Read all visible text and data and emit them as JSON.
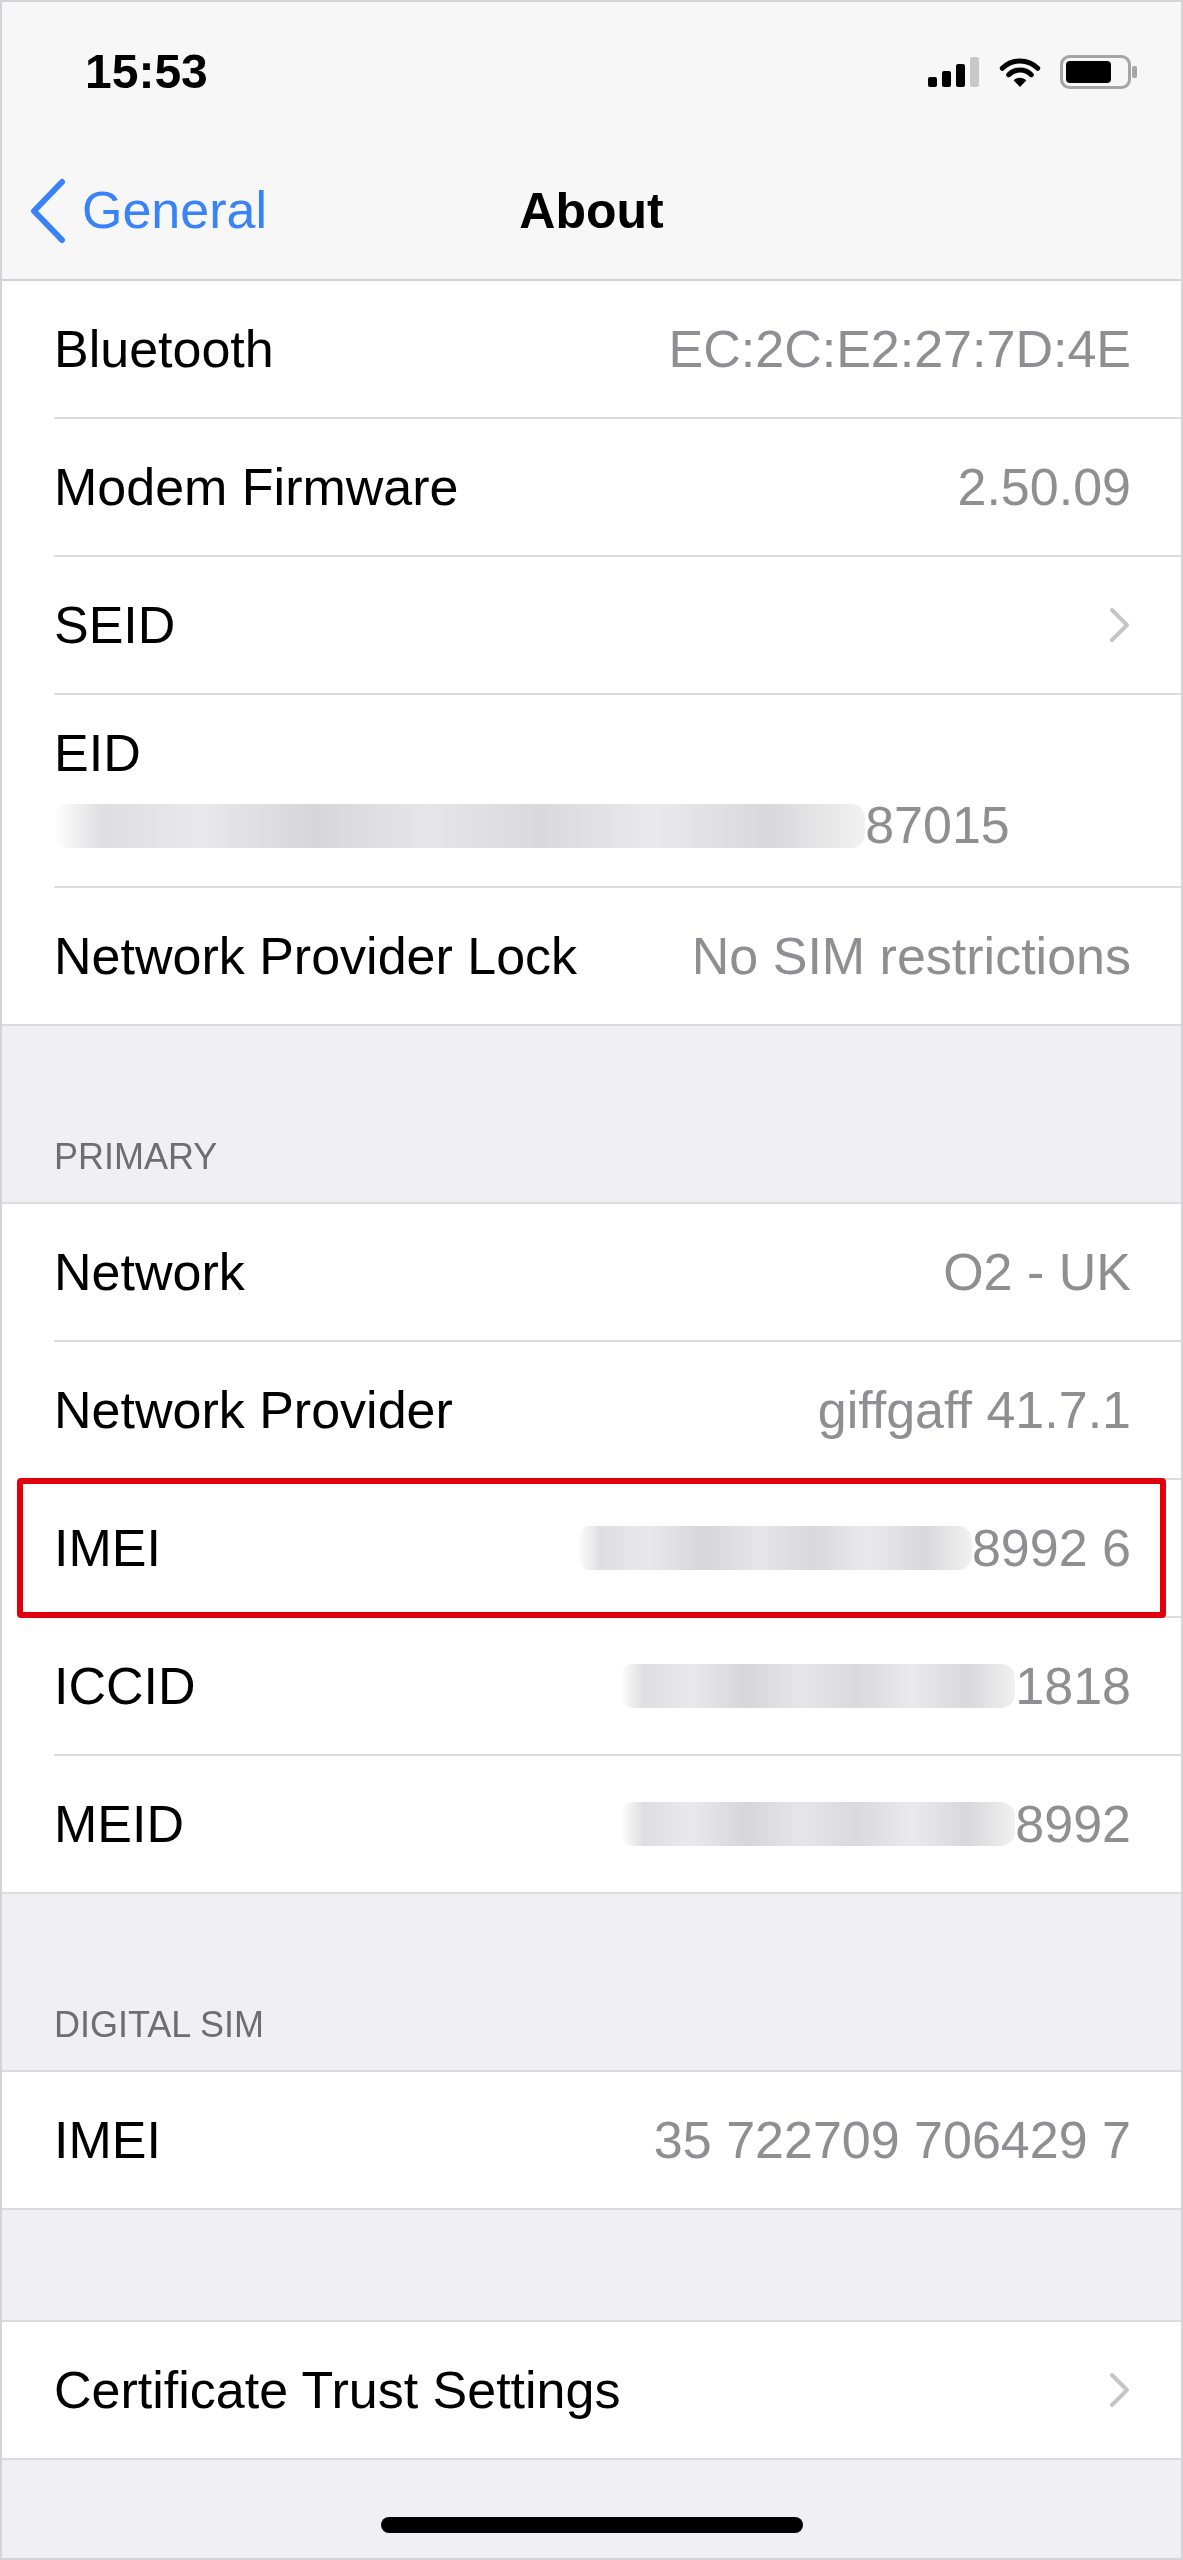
{
  "status_bar": {
    "time": "15:53"
  },
  "nav": {
    "back_label": "General",
    "title": "About"
  },
  "groups": [
    {
      "rows": [
        {
          "kind": "value",
          "label": "Bluetooth",
          "value": "EC:2C:E2:27:7D:4E",
          "redacted": false,
          "highlighted": false
        },
        {
          "kind": "value",
          "label": "Modem Firmware",
          "value": "2.50.09",
          "redacted": false,
          "highlighted": false
        },
        {
          "kind": "link",
          "label": "SEID",
          "highlighted": false
        },
        {
          "kind": "stacked",
          "label": "EID",
          "value": "87015",
          "redacted": true,
          "highlighted": false
        },
        {
          "kind": "value",
          "label": "Network Provider Lock",
          "value": "No SIM restrictions",
          "redacted": false,
          "highlighted": false
        }
      ]
    },
    {
      "header": "PRIMARY",
      "rows": [
        {
          "kind": "value",
          "label": "Network",
          "value": "O2 - UK",
          "redacted": false,
          "highlighted": false
        },
        {
          "kind": "value",
          "label": "Network Provider",
          "value": "giffgaff 41.7.1",
          "redacted": false,
          "highlighted": false
        },
        {
          "kind": "value",
          "label": "IMEI",
          "value": "8992 6",
          "redacted": true,
          "highlighted": true
        },
        {
          "kind": "value",
          "label": "ICCID",
          "value": "1818",
          "redacted": true,
          "highlighted": false
        },
        {
          "kind": "value",
          "label": "MEID",
          "value": "8992",
          "redacted": true,
          "highlighted": false
        }
      ]
    },
    {
      "header": "DIGITAL SIM",
      "rows": [
        {
          "kind": "value",
          "label": "IMEI",
          "value": "35 722709 706429 7",
          "redacted": false,
          "highlighted": false
        }
      ]
    },
    {
      "rows": [
        {
          "kind": "link",
          "label": "Certificate Trust Settings",
          "highlighted": false
        }
      ]
    }
  ]
}
